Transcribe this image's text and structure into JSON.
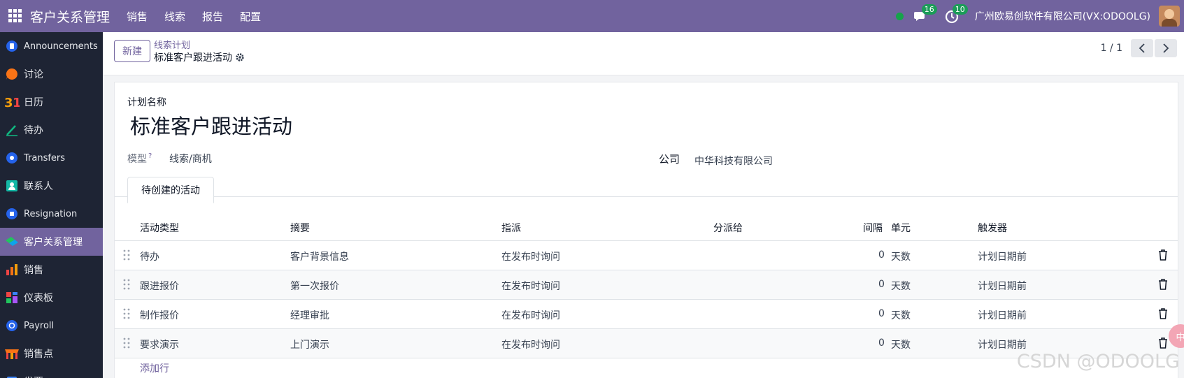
{
  "topbar": {
    "app_name": "客户关系管理",
    "menu": [
      "销售",
      "线索",
      "报告",
      "配置"
    ],
    "chat_badge": "16",
    "activity_badge": "10",
    "company": "广州欧易创软件有限公司(VX:ODOOLG)"
  },
  "sidebar": {
    "items": [
      {
        "label": "Announcements",
        "icon": "announcements-icon",
        "color": "#3b82f6"
      },
      {
        "label": "讨论",
        "icon": "discuss-icon",
        "color": "#f97316"
      },
      {
        "label": "日历",
        "icon": "calendar-icon",
        "color": "#f59e0b"
      },
      {
        "label": "待办",
        "icon": "todo-icon",
        "color": "#10b981"
      },
      {
        "label": "Transfers",
        "icon": "transfers-icon",
        "color": "#3b82f6"
      },
      {
        "label": "联系人",
        "icon": "contacts-icon",
        "color": "#14b8a6"
      },
      {
        "label": "Resignation",
        "icon": "resignation-icon",
        "color": "#3b82f6"
      },
      {
        "label": "客户关系管理",
        "icon": "crm-icon",
        "color": "#22c55e"
      },
      {
        "label": "销售",
        "icon": "sales-icon",
        "color": "#f97316"
      },
      {
        "label": "仪表板",
        "icon": "dashboard-icon",
        "color": "#ef4444"
      },
      {
        "label": "Payroll",
        "icon": "payroll-icon",
        "color": "#3b82f6"
      },
      {
        "label": "销售点",
        "icon": "pos-icon",
        "color": "#f97316"
      },
      {
        "label": "发票",
        "icon": "invoice-icon",
        "color": "#3b82f6"
      }
    ]
  },
  "control": {
    "new_label": "新建",
    "breadcrumb_parent": "线索计划",
    "breadcrumb_current": "标准客户跟进活动",
    "pager": "1 / 1"
  },
  "form": {
    "plan_name_label": "计划名称",
    "plan_name": "标准客户跟进活动",
    "model_label": "模型",
    "model_help": "?",
    "model_value": "线索/商机",
    "company_label": "公司",
    "company_value": "中华科技有限公司",
    "tab_label": "待创建的活动"
  },
  "table": {
    "headers": {
      "type": "活动类型",
      "summary": "摘要",
      "assign": "指派",
      "assigned_to": "分派给",
      "interval": "间隔",
      "unit": "单元",
      "trigger": "触发器"
    },
    "rows": [
      {
        "type": "待办",
        "summary": "客户背景信息",
        "assign": "在发布时询问",
        "interval": "0",
        "unit": "天数",
        "trigger": "计划日期前"
      },
      {
        "type": "跟进报价",
        "summary": "第一次报价",
        "assign": "在发布时询问",
        "interval": "0",
        "unit": "天数",
        "trigger": "计划日期前"
      },
      {
        "type": "制作报价",
        "summary": "经理审批",
        "assign": "在发布时询问",
        "interval": "0",
        "unit": "天数",
        "trigger": "计划日期前"
      },
      {
        "type": "要求演示",
        "summary": "上门演示",
        "assign": "在发布时询问",
        "interval": "0",
        "unit": "天数",
        "trigger": "计划日期前"
      }
    ],
    "add_line": "添加行"
  },
  "watermark": "CSDN @ODOOLG",
  "float_button": "中",
  "colors": {
    "brand": "#71639e",
    "sidebar_bg": "#1e2434",
    "online": "#16a34a",
    "badge": "#1b9c58"
  }
}
